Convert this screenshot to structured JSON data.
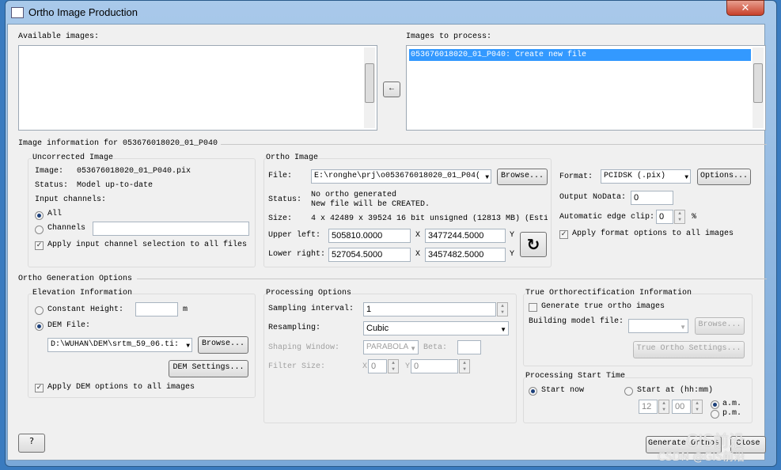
{
  "window": {
    "title": "Ortho Image Production",
    "close": "✕"
  },
  "lists": {
    "available_label": "Available images:",
    "process_label": "Images to process:",
    "process_items": [
      "053676018020_01_P040: Create new file"
    ],
    "move_arrow": "←"
  },
  "info": {
    "header": "Image information for 053676018020_01_P040",
    "uncorrected": {
      "title": "Uncorrected Image",
      "image_label": "Image:",
      "image_value": "053676018020_01_P040.pix",
      "status_label": "Status:",
      "status_value": "Model up-to-date",
      "channels_label": "Input channels:",
      "all": "All",
      "channels": "Channels",
      "channels_value": "",
      "apply": "Apply input channel selection to all files"
    },
    "ortho": {
      "title": "Ortho Image",
      "file_label": "File:",
      "file_value": "E:\\ronghe\\prj\\o053676018020_01_P04(",
      "browse": "Browse...",
      "status_label": "Status:",
      "status_line1": "No ortho generated",
      "status_line2": "New file will be CREATED.",
      "size_label": "Size:",
      "size_value": "4 x 42489 x 39524 16 bit unsigned (12813 MB) (Esti",
      "ul_label": "Upper left:",
      "ul_x": "505810.0000",
      "ul_y": "3477244.5000",
      "lr_label": "Lower right:",
      "lr_x": "527054.5000",
      "lr_y": "3457482.5000",
      "x": "X",
      "y": "Y"
    },
    "format": {
      "label": "Format:",
      "value": "PCIDSK (.pix)",
      "options": "Options...",
      "nodata_label": "Output NoData:",
      "nodata_value": "0",
      "clip_label": "Automatic edge clip:",
      "clip_value": "0",
      "clip_unit": "%",
      "apply": "Apply format options to all images"
    }
  },
  "gen": {
    "header": "Ortho Generation Options",
    "elev": {
      "title": "Elevation Information",
      "const": "Constant Height:",
      "const_value": "",
      "unit": "m",
      "dem": "DEM File:",
      "dem_value": "D:\\WUHAN\\DEM\\srtm_59_06.ti:",
      "browse": "Browse...",
      "settings": "DEM Settings...",
      "apply": "Apply DEM options to all images"
    },
    "proc": {
      "title": "Processing Options",
      "sampling_label": "Sampling interval:",
      "sampling_value": "1",
      "resampling_label": "Resampling:",
      "resampling_value": "Cubic",
      "shaping_label": "Shaping Window:",
      "shaping_value": "PARABOLA",
      "beta_label": "Beta:",
      "beta_value": "",
      "filter_label": "Filter Size:",
      "fx": "X",
      "fx_value": "0",
      "fy": "Y",
      "fy_value": "0"
    },
    "true": {
      "title": "True Orthorectification Information",
      "generate": "Generate true ortho images",
      "building_label": "Building model file:",
      "browse": "Browse...",
      "settings": "True Ortho Settings..."
    },
    "start": {
      "title": "Processing Start Time",
      "now": "Start now",
      "at": "Start at (hh:mm)",
      "hh": "12",
      "mm": "00",
      "am": "a.m.",
      "pm": "p.m."
    }
  },
  "footer": {
    "generate": "Generate Orthos",
    "close": "Close",
    "help_icon": "help-icon",
    "watermark1": "GIS前沿",
    "watermark2": "CSDN @GIS前沿"
  }
}
